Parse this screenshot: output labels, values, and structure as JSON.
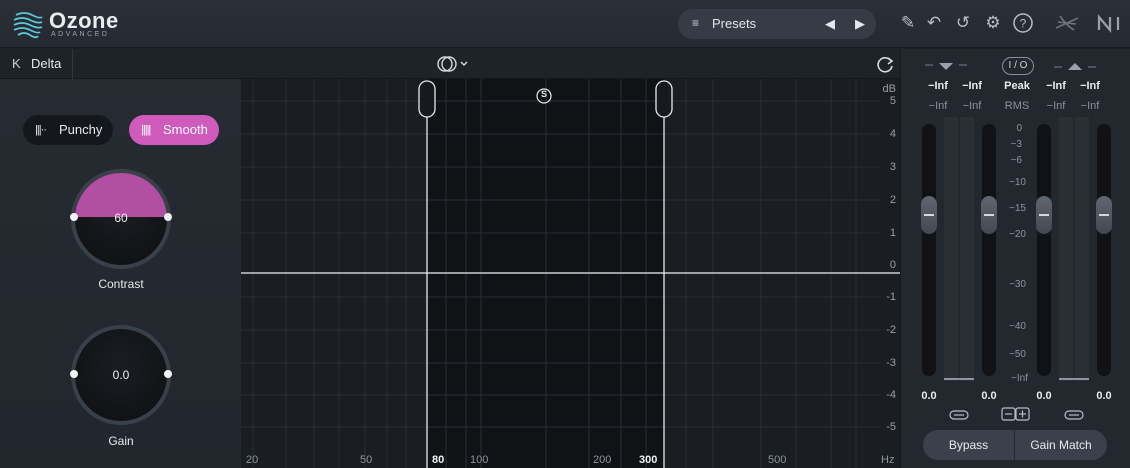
{
  "app": {
    "brand": "Ozone",
    "brand_sub": "ADVANCED"
  },
  "toolbar": {
    "presets_label": "Presets",
    "icons": [
      "list-icon",
      "prev-arrow-icon",
      "next-arrow-icon",
      "pencil-icon",
      "undo-icon",
      "history-icon",
      "settings-icon",
      "help-icon",
      "signal-chain-icon",
      "ni-logo-icon"
    ]
  },
  "subbar": {
    "delta_label": "Delta"
  },
  "left": {
    "punchy_label": "Punchy",
    "smooth_label": "Smooth",
    "active_mode": "Smooth",
    "contrast": {
      "value": "60",
      "label": "Contrast"
    },
    "gain": {
      "value": "0.0",
      "label": "Gain"
    }
  },
  "graph": {
    "db_unit": "dB",
    "db_ticks": [
      "5",
      "4",
      "3",
      "2",
      "1",
      "0",
      "-1",
      "-2",
      "-3",
      "-4",
      "-5"
    ],
    "hz_ticks": [
      "20",
      "50",
      "100",
      "200",
      "500"
    ],
    "hz_unit": "Hz",
    "band_low": "80",
    "band_high": "300",
    "solo_label": "S"
  },
  "meters": {
    "io_label": "I / O",
    "peak_label": "Peak",
    "rms_label": "RMS",
    "in_peak": [
      "−Inf",
      "−Inf"
    ],
    "in_rms": [
      "−Inf",
      "−Inf"
    ],
    "out_peak": [
      "−Inf",
      "−Inf"
    ],
    "out_rms": [
      "−Inf",
      "−Inf"
    ],
    "scale": [
      "0",
      "−3",
      "−6",
      "−10",
      "−15",
      "−20",
      "−30",
      "−40",
      "−50",
      "−Inf"
    ],
    "values": [
      "0.0",
      "0.0",
      "0.0",
      "0.0"
    ],
    "bypass_label": "Bypass",
    "gain_match_label": "Gain Match"
  },
  "colors": {
    "accent": "#cf5bbd",
    "background": "#1c2027",
    "panel": "#23272e"
  }
}
